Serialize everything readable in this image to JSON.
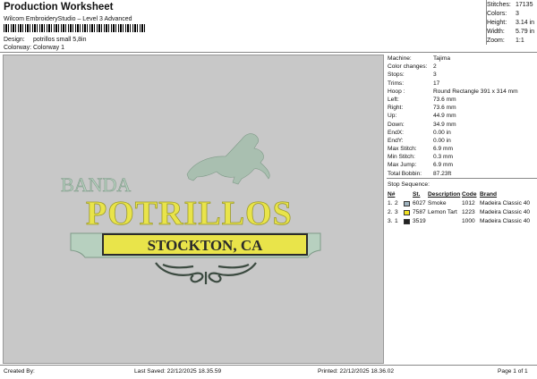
{
  "header": {
    "title": "Production Worksheet",
    "subtitle": "Wilcom EmbroideryStudio – Level 3 Advanced",
    "design_label": "Design:",
    "design_value": "potrillos small 5,8in",
    "colorway_label": "Colorway:",
    "colorway_value": "Colorway 1"
  },
  "summary": [
    {
      "k": "Stitches:",
      "v": "17135"
    },
    {
      "k": "Colors:",
      "v": "3"
    },
    {
      "k": "Height:",
      "v": "3.14 in"
    },
    {
      "k": "Width:",
      "v": "5.79 in"
    },
    {
      "k": "Zoom:",
      "v": "1:1"
    }
  ],
  "design": {
    "banda": "BANDA",
    "potrillos": "POTRILLOS",
    "stockton": "STOCKTON, CA"
  },
  "machine_info": [
    {
      "k": "Machine:",
      "v": "Tajima"
    },
    {
      "k": "Color changes:",
      "v": "2"
    },
    {
      "k": "Stops:",
      "v": "3"
    },
    {
      "k": "Trims:",
      "v": "17"
    },
    {
      "k": "Hoop :",
      "v": "Round Rectangle 391 x 314 mm"
    },
    {
      "k": "Left:",
      "v": "73.6 mm"
    },
    {
      "k": "Right:",
      "v": "73.6 mm"
    },
    {
      "k": "Up:",
      "v": "44.9 mm"
    },
    {
      "k": "Down:",
      "v": "34.9 mm"
    },
    {
      "k": "EndX:",
      "v": "0.00 in"
    },
    {
      "k": "EndY:",
      "v": "0.00 in"
    },
    {
      "k": "Max Stitch:",
      "v": "6.9 mm"
    },
    {
      "k": "Min Stitch:",
      "v": "0.3 mm"
    },
    {
      "k": "Max Jump:",
      "v": "6.9 mm"
    },
    {
      "k": "Total Bobbin:",
      "v": "87.23ft"
    }
  ],
  "stop_sequence": {
    "title": "Stop Sequence:",
    "headers": {
      "n": "N#",
      "st": "St.",
      "desc": "Description",
      "code": "Code",
      "brand": "Brand"
    },
    "rows": [
      {
        "n": "1.",
        "stop": "2",
        "color": "#9fb3bf",
        "st": "6027",
        "desc": "Smoke",
        "code": "1012",
        "brand": "Madeira Classic 40"
      },
      {
        "n": "2.",
        "stop": "3",
        "color": "#f0e020",
        "st": "7587",
        "desc": "Lemon Tart",
        "code": "1223",
        "brand": "Madeira Classic 40"
      },
      {
        "n": "3.",
        "stop": "1",
        "color": "#222222",
        "st": "3519",
        "desc": "",
        "code": "1000",
        "brand": "Madeira Classic 40"
      }
    ]
  },
  "footer": {
    "created": "Created By:",
    "saved": "Last Saved: 22/12/2025 18.35.59",
    "printed": "Printed: 22/12/2025 18.36.02",
    "page": "Page 1 of 1"
  }
}
